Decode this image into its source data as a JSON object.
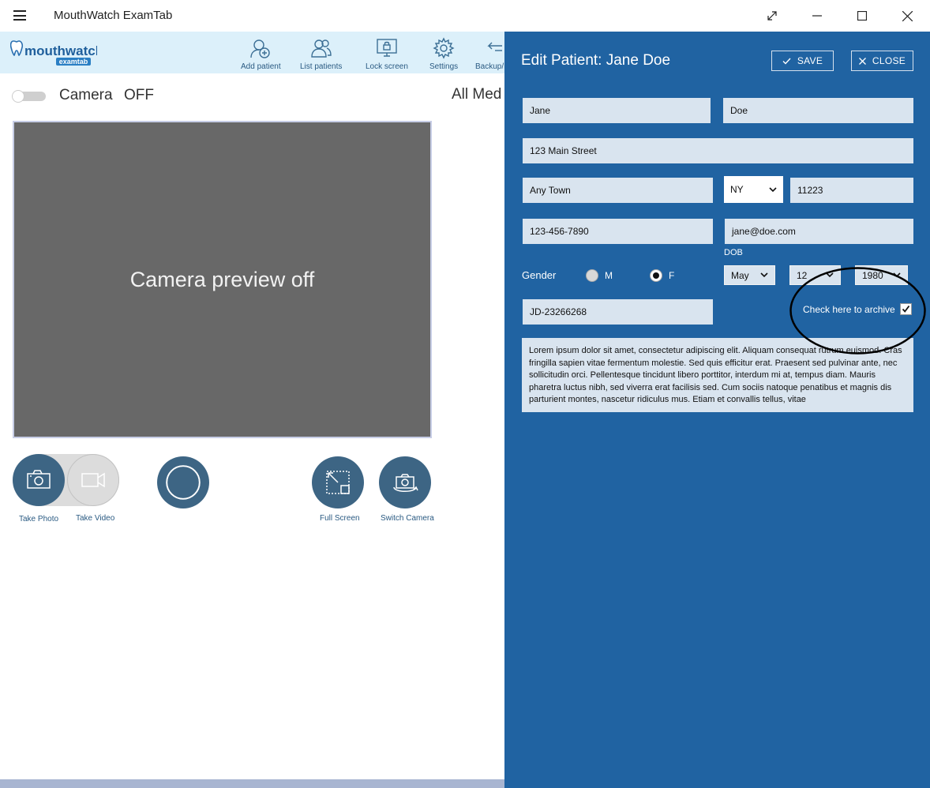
{
  "window": {
    "title": "MouthWatch ExamTab"
  },
  "logo": {
    "brand": "mouthwatch",
    "sub": "examtab"
  },
  "toolbar": {
    "items": [
      {
        "label": "Add patient",
        "icon": "add-user-icon"
      },
      {
        "label": "List patients",
        "icon": "users-icon"
      },
      {
        "label": "Lock screen",
        "icon": "lock-screen-icon"
      },
      {
        "label": "Settings",
        "icon": "gear-icon"
      },
      {
        "label": "Backup/R",
        "icon": "backup-icon"
      }
    ]
  },
  "camera": {
    "label": "Camera",
    "state": "OFF",
    "preview_text": "Camera preview off",
    "all_media": "All Med"
  },
  "controls": {
    "take_photo": "Take Photo",
    "take_video": "Take Video",
    "full_screen": "Full Screen",
    "switch_camera": "Switch Camera"
  },
  "edit_panel": {
    "title": "Edit Patient: Jane Doe",
    "save_label": "SAVE",
    "close_label": "CLOSE",
    "first_name": "Jane",
    "last_name": "Doe",
    "address": "123 Main Street",
    "city": "Any Town",
    "state": "NY",
    "zip": "11223",
    "phone": "123-456-7890",
    "email": "jane@doe.com",
    "gender_label": "Gender",
    "gender_options": [
      "M",
      "F"
    ],
    "gender_selected": "F",
    "dob_label": "DOB",
    "dob_month": "May",
    "dob_day": "12",
    "dob_year": "1980",
    "patient_id": "JD-23266268",
    "archive_label": "Check here to archive",
    "archived": true,
    "notes": "Lorem ipsum dolor sit amet, consectetur adipiscing elit. Aliquam consequat rutrum euismod. Cras fringilla sapien vitae fermentum molestie. Sed quis efficitur erat. Praesent sed pulvinar ante, nec sollicitudin orci. Pellentesque tincidunt libero porttitor, interdum mi at, tempus diam. Mauris pharetra luctus nibh, sed viverra erat facilisis sed. Cum sociis natoque penatibus et magnis dis parturient montes, nascetur ridiculus mus. Etiam et convallis tellus, vitae"
  },
  "colors": {
    "panel_bg": "#2063a2",
    "toolbar_bg": "#dcf0fa",
    "button_dark": "#3d6584",
    "field_bg": "#d9e4ef"
  }
}
